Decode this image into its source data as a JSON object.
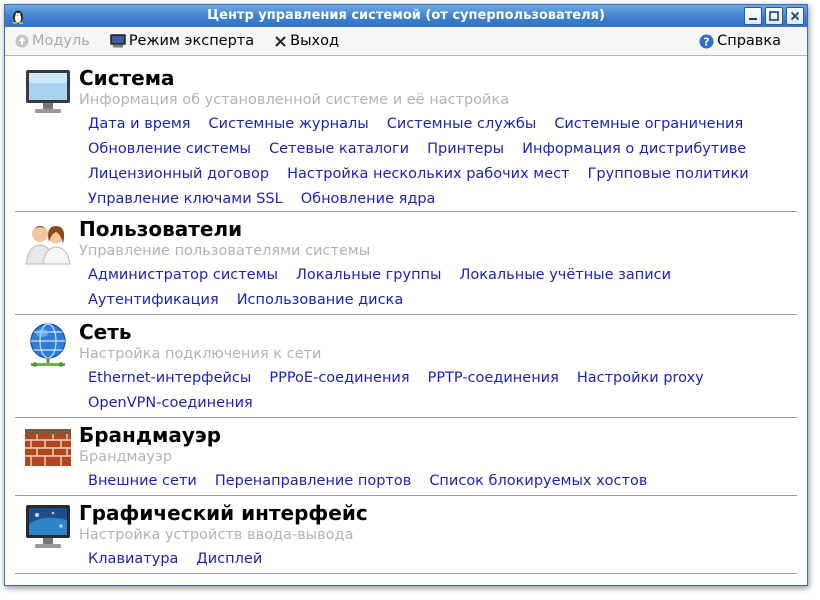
{
  "window": {
    "title": "Центр управления системой (от суперпользователя)"
  },
  "toolbar": {
    "module_label": "Модуль",
    "expert_label": "Режим эксперта",
    "exit_label": "Выход",
    "help_label": "Справка"
  },
  "sections": [
    {
      "title": "Система",
      "desc": "Информация об установленной системе и её настройка",
      "icon": "monitor-icon",
      "rows": [
        [
          "Дата и время",
          "Системные журналы",
          "Системные службы",
          "Системные ограничения"
        ],
        [
          "Обновление системы",
          "Сетевые каталоги",
          "Принтеры",
          "Информация о дистрибутиве"
        ],
        [
          "Лицензионный договор",
          "Настройка нескольких рабочих мест",
          "Групповые политики"
        ],
        [
          "Управление ключами SSL",
          "Обновление ядра"
        ]
      ]
    },
    {
      "title": "Пользователи",
      "desc": "Управление пользователями системы",
      "icon": "users-icon",
      "rows": [
        [
          "Администратор системы",
          "Локальные группы",
          "Локальные учётные записи"
        ],
        [
          "Аутентификация",
          "Использование диска"
        ]
      ]
    },
    {
      "title": "Сеть",
      "desc": "Настройка подключения к сети",
      "icon": "globe-network-icon",
      "rows": [
        [
          "Ethernet-интерфейсы",
          "PPPoE-соединения",
          "PPTP-соединения",
          "Настройки proxy"
        ],
        [
          "OpenVPN-соединения"
        ]
      ]
    },
    {
      "title": "Брандмауэр",
      "desc": "Брандмауэр",
      "icon": "brick-wall-icon",
      "rows": [
        [
          "Внешние сети",
          "Перенаправление портов",
          "Список блокируемых хостов"
        ]
      ]
    },
    {
      "title": "Графический интерфейс",
      "desc": "Настройка устройств ввода-вывода",
      "icon": "display-icon",
      "rows": [
        [
          "Клавиатура",
          "Дисплей"
        ]
      ]
    }
  ]
}
